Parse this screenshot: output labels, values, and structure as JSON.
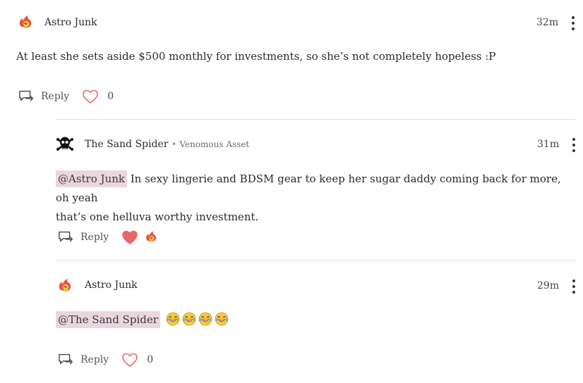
{
  "comments": [
    {
      "author": "Astro Junk",
      "flair": "",
      "time": "32m",
      "text": "At least she sets aside $500 monthly for investments, so she’s not completely hopeless :P",
      "reply_label": "Reply",
      "likes": "0",
      "liked": false,
      "avatar_icon": "fireball-icon"
    },
    {
      "author": "The Sand Spider",
      "separator": "•",
      "flair": "Venomous Asset",
      "time": "31m",
      "mention": "@Astro Junk",
      "text_line1": " In sexy lingerie and BDSM gear to keep her sugar daddy coming back for more, oh yeah",
      "text_line2": "that’s one helluva worthy investment.",
      "reply_label": "Reply",
      "liked": true,
      "avatar_icon": "skull-crossbones-icon"
    },
    {
      "author": "Astro Junk",
      "flair": "",
      "time": "29m",
      "mention": "@The Sand Spider",
      "emojis": [
        "laughing-tears-emoji",
        "laughing-tears-emoji",
        "laughing-tears-emoji",
        "laughing-tears-emoji"
      ],
      "reply_label": "Reply",
      "likes": "0",
      "liked": false,
      "avatar_icon": "fireball-icon"
    }
  ],
  "colors": {
    "heart_outline": "#e8676b",
    "heart_filled": "#e8676b",
    "mention_bg": "#ecd6dc",
    "divider": "#dcdcdc"
  }
}
